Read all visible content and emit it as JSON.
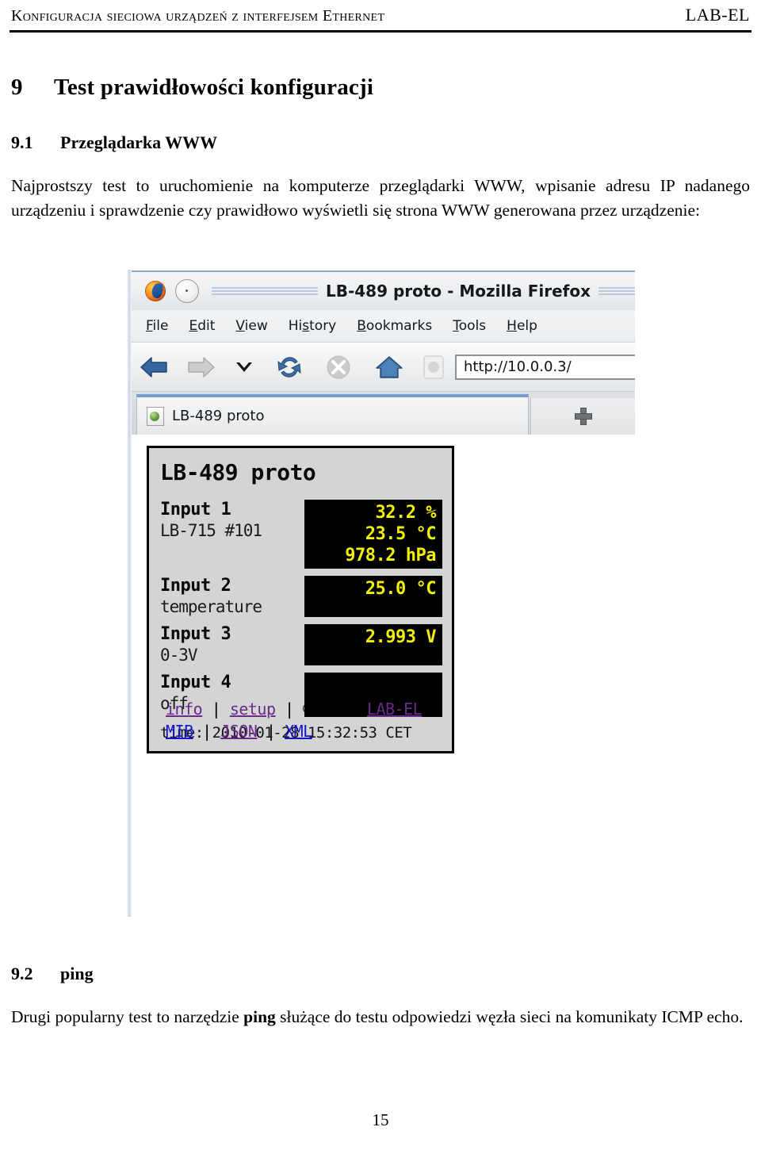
{
  "header": {
    "left": "Konfiguracja sieciowa urządzeń z interfejsem Ethernet",
    "right": "LAB-EL"
  },
  "sections": {
    "h1_number": "9",
    "h1_title": "Test prawidłowości konfiguracji",
    "h2_1_number": "9.1",
    "h2_1_title": "Przeglądarka WWW",
    "para_1": "Najprostszy test to uruchomienie na komputerze przeglądarki WWW, wpisanie adresu IP nadanego urządzeniu i sprawdzenie czy prawidłowo wyświetli się strona WWW generowana przez urządzenie:",
    "h2_2_number": "9.2",
    "h2_2_title": "ping",
    "para_2_before": "Drugi popularny test to narzędzie ",
    "para_2_bold": "ping",
    "para_2_after": " służące do testu odpowiedzi węzła sieci na komunikaty ICMP echo."
  },
  "browser": {
    "window_title": "LB-489 proto - Mozilla Firefox",
    "menu": [
      {
        "pre": "",
        "accel": "F",
        "post": "ile"
      },
      {
        "pre": "",
        "accel": "E",
        "post": "dit"
      },
      {
        "pre": "",
        "accel": "V",
        "post": "iew"
      },
      {
        "pre": "Hi",
        "accel": "s",
        "post": "tory"
      },
      {
        "pre": "",
        "accel": "B",
        "post": "ookmarks"
      },
      {
        "pre": "",
        "accel": "T",
        "post": "ools"
      },
      {
        "pre": "",
        "accel": "H",
        "post": "elp"
      }
    ],
    "url": "http://10.0.0.3/",
    "tab_label": "LB-489 proto",
    "toolbar_icons": [
      "back-arrow-icon",
      "forward-arrow-icon",
      "chevron-down-icon",
      "reload-icon",
      "stop-icon",
      "home-icon",
      "site-identity-icon"
    ],
    "new_tab_label": "+"
  },
  "device_page": {
    "title": "LB-489 proto",
    "rows": [
      {
        "name": "Input 1",
        "sub": "LB-715 #101",
        "values": [
          "32.2 %",
          "23.5 °C",
          "978.2 hPa"
        ]
      },
      {
        "name": "Input 2",
        "sub": "temperature",
        "values": [
          "25.0 °C"
        ]
      },
      {
        "name": "Input 3",
        "sub": "0-3V",
        "values": [
          "2.993 V"
        ]
      },
      {
        "name": "Input 4",
        "sub": "off",
        "values": []
      }
    ],
    "time": "time: 2010-01-28 15:32:53 CET",
    "links_row1": {
      "info": "info",
      "sep1": "|",
      "setup": "setup",
      "sep2": "|",
      "copyright": "© 2009",
      "labbel": "LAB-EL"
    },
    "links_row2": {
      "mib": "MIB",
      "sep1": "|",
      "json": "JSON",
      "sep2": "|",
      "xml": "XML"
    },
    "colors": {
      "readout_text": "#f2f200",
      "readout_bg": "#000000",
      "panel_bg": "#d4d4d4",
      "link_visited": "#6a2a8c",
      "link_blue": "#1616c8"
    }
  },
  "folio": "15"
}
